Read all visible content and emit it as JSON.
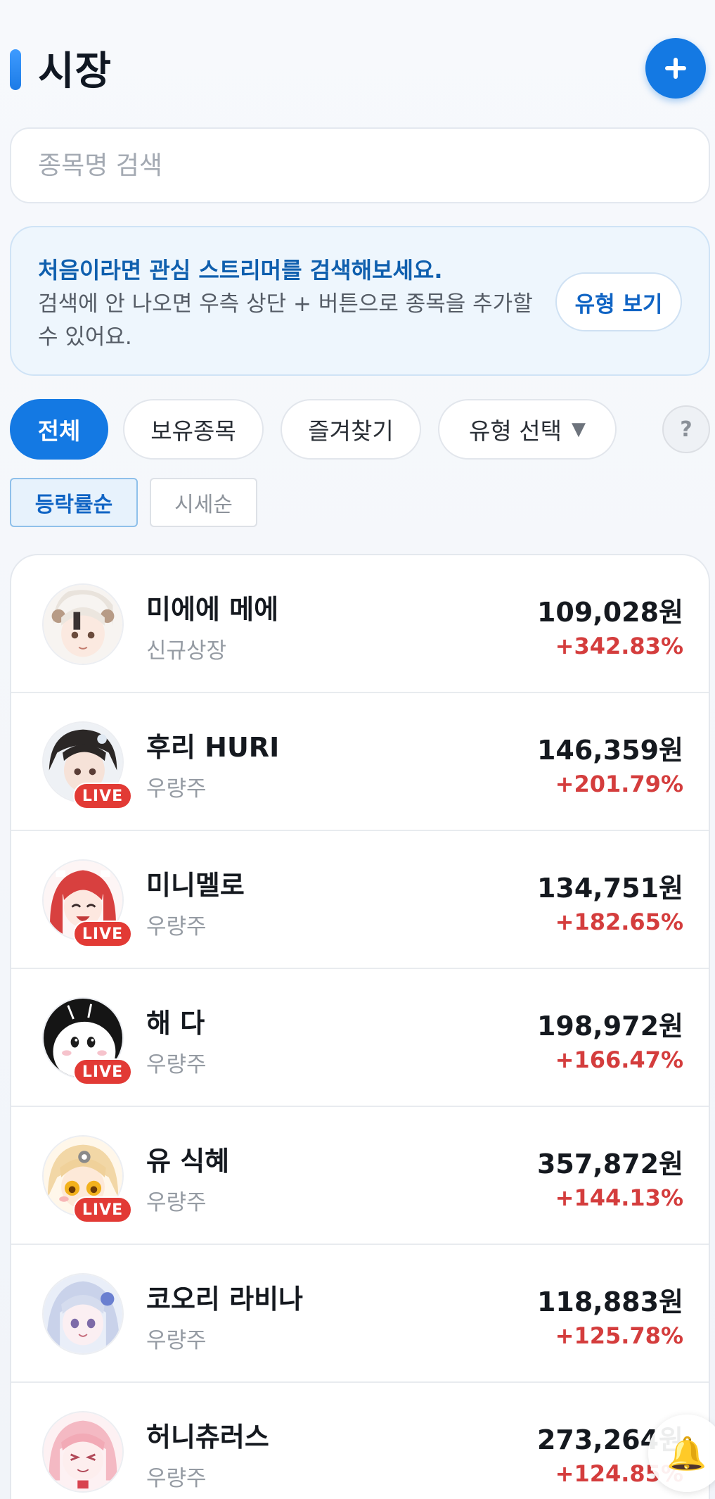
{
  "header": {
    "title": "시장",
    "add_icon": "plus-icon"
  },
  "search": {
    "placeholder": "종목명 검색",
    "value": ""
  },
  "info": {
    "title": "처음이라면 관심 스트리머를 검색해보세요.",
    "description": "검색에 안 나오면 우측 상단 + 버튼으로 종목을 추가할 수 있어요.",
    "button": "유형 보기"
  },
  "filters": {
    "chips": [
      "전체",
      "보유종목",
      "즐겨찾기",
      "유형 선택"
    ],
    "selected": "전체",
    "dropdown_icon": "▼",
    "help": "?"
  },
  "sort": {
    "tabs": [
      "등락률순",
      "시세순"
    ],
    "selected": "등락률순"
  },
  "colors": {
    "accent": "#1479e3",
    "up": "#d43d3d",
    "live": "#e23a35"
  },
  "stocks": [
    {
      "name": "미에에 메에",
      "category": "신규상장",
      "price": "109,028원",
      "change": "+342.83%",
      "live": false
    },
    {
      "name": "후리 HURI",
      "category": "우량주",
      "price": "146,359원",
      "change": "+201.79%",
      "live": true
    },
    {
      "name": "미니멜로",
      "category": "우량주",
      "price": "134,751원",
      "change": "+182.65%",
      "live": true
    },
    {
      "name": "해 다",
      "category": "우량주",
      "price": "198,972원",
      "change": "+166.47%",
      "live": true
    },
    {
      "name": "유 식혜",
      "category": "우량주",
      "price": "357,872원",
      "change": "+144.13%",
      "live": true
    },
    {
      "name": "코오리 라비나",
      "category": "우량주",
      "price": "118,883원",
      "change": "+125.78%",
      "live": false
    },
    {
      "name": "허니츄러스",
      "category": "우량주",
      "price": "273,264원",
      "change": "+124.85%",
      "live": false
    }
  ],
  "live_label": "LIVE",
  "bell_icon": "bell-icon"
}
